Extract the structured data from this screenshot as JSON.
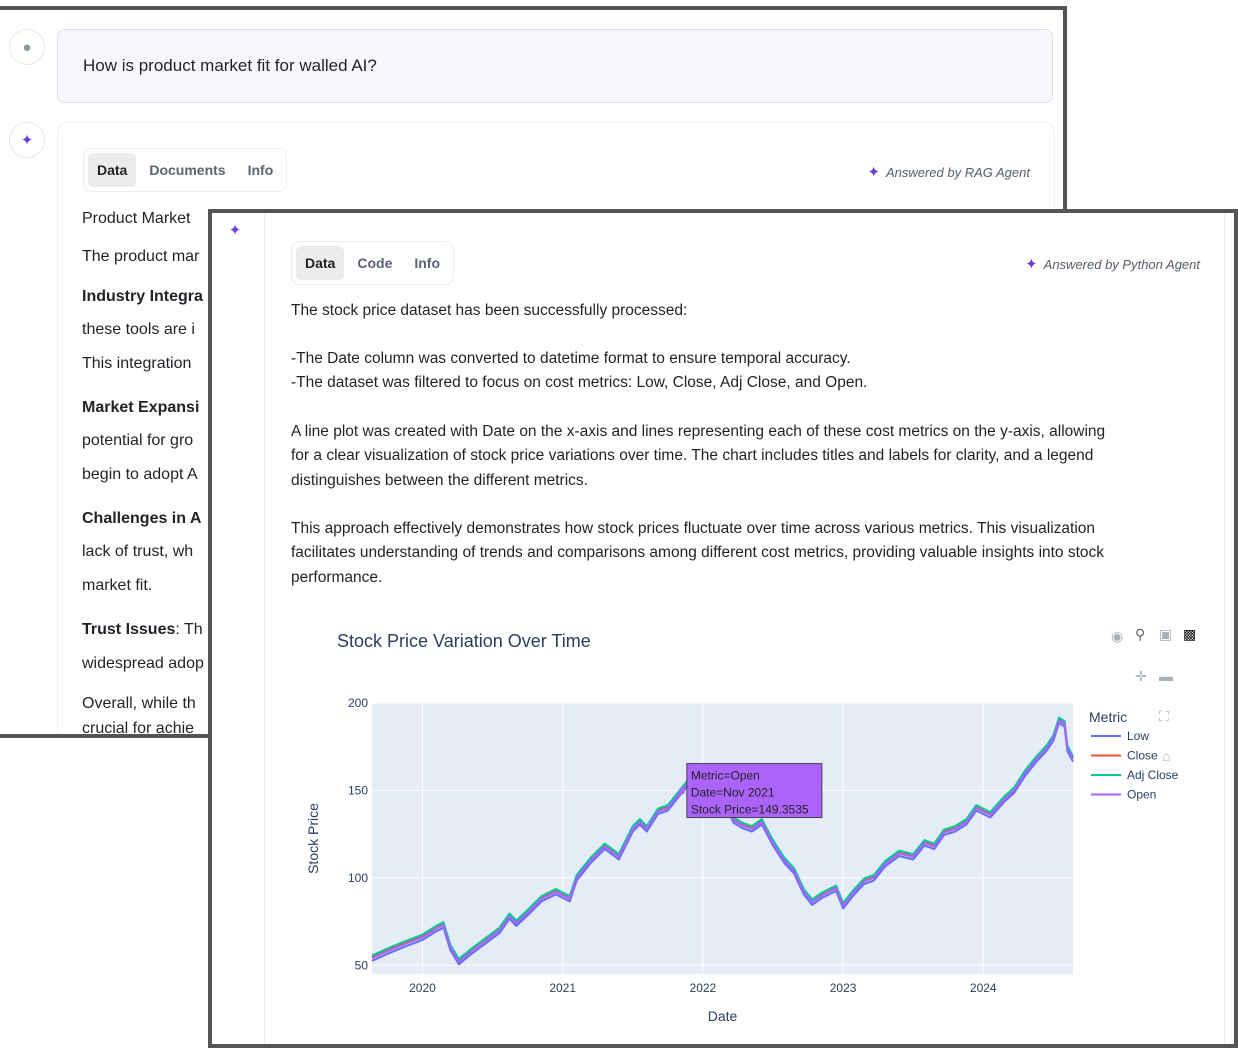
{
  "window_back": {
    "question": "How is product market fit for walled AI?",
    "tabs": [
      "Data",
      "Documents",
      "Info"
    ],
    "answered_by": "Answered by RAG Agent",
    "lines": [
      {
        "bold": "",
        "rest": "Product Market"
      },
      {
        "bold": "",
        "rest": "The product mar"
      },
      {
        "bold": "Industry Integra",
        "rest": ""
      },
      {
        "bold": "",
        "rest": "these tools are i"
      },
      {
        "bold": "",
        "rest": "This integration"
      },
      {
        "bold": "Market Expansi",
        "rest": ""
      },
      {
        "bold": "",
        "rest": "potential for gro"
      },
      {
        "bold": "",
        "rest": "begin to adopt A"
      },
      {
        "bold": "Challenges in A",
        "rest": ""
      },
      {
        "bold": "",
        "rest": "lack of trust, wh"
      },
      {
        "bold": "",
        "rest": "market fit."
      },
      {
        "bold": "Trust Issues",
        "rest": ": Th"
      },
      {
        "bold": "",
        "rest": "widespread adop"
      },
      {
        "bold": "",
        "rest": "Overall, while th"
      },
      {
        "bold": "",
        "rest": "crucial for achie"
      }
    ]
  },
  "window_front": {
    "tabs": [
      "Data",
      "Code",
      "Info"
    ],
    "answered_by": "Answered by Python Agent",
    "paragraphs": [
      [
        "The stock price dataset has been successfully processed:"
      ],
      [
        "-The Date column was converted to datetime format to ensure temporal accuracy.",
        "-The dataset was filtered to focus on cost metrics: Low, Close, Adj Close, and Open."
      ],
      [
        "A line plot was created with Date on the x-axis and lines representing each of these cost metrics on the y-axis, allowing",
        "for a clear visualization of stock price variations over time. The chart includes titles and labels for clarity, and a legend",
        "distinguishes between the different metrics."
      ],
      [
        "This approach effectively demonstrates how stock prices fluctuate over time across various metrics. This visualization",
        "facilitates understanding of trends and comparisons among different cost metrics, providing valuable insights into stock",
        "performance."
      ]
    ]
  },
  "chart_data": {
    "type": "line",
    "title": "Stock Price Variation Over Time",
    "xlabel": "Date",
    "ylabel": "Stock Price",
    "x_ticks": [
      "2020",
      "2021",
      "2022",
      "2023",
      "2024"
    ],
    "y_ticks": [
      50,
      100,
      150,
      200
    ],
    "xlim": [
      2019.64,
      2024.64
    ],
    "ylim": [
      45,
      200
    ],
    "grid": true,
    "legend_title": "Metric",
    "legend_placement": "right",
    "series": [
      {
        "name": "Low",
        "color": "#636efa"
      },
      {
        "name": "Close",
        "color": "#ef553b"
      },
      {
        "name": "Adj Close",
        "color": "#00cc96"
      },
      {
        "name": "Open",
        "color": "#ab63fa"
      }
    ],
    "x": [
      2019.64,
      2019.75,
      2019.87,
      2020.0,
      2020.1,
      2020.15,
      2020.2,
      2020.26,
      2020.35,
      2020.45,
      2020.55,
      2020.62,
      2020.67,
      2020.75,
      2020.85,
      2020.95,
      2021.05,
      2021.1,
      2021.2,
      2021.3,
      2021.4,
      2021.5,
      2021.55,
      2021.6,
      2021.68,
      2021.75,
      2021.8,
      2021.85,
      2021.9,
      2021.95,
      2022.0,
      2022.08,
      2022.15,
      2022.22,
      2022.28,
      2022.35,
      2022.42,
      2022.5,
      2022.58,
      2022.65,
      2022.72,
      2022.78,
      2022.85,
      2022.95,
      2023.0,
      2023.08,
      2023.15,
      2023.22,
      2023.3,
      2023.4,
      2023.5,
      2023.58,
      2023.65,
      2023.72,
      2023.8,
      2023.88,
      2023.95,
      2024.05,
      2024.15,
      2024.22,
      2024.3,
      2024.38,
      2024.45,
      2024.5,
      2024.54,
      2024.58,
      2024.6,
      2024.64
    ],
    "y": [
      54,
      58,
      62,
      66,
      71,
      73,
      60,
      52,
      58,
      64,
      70,
      78,
      74,
      80,
      88,
      92,
      88,
      100,
      110,
      118,
      112,
      128,
      132,
      128,
      138,
      140,
      145,
      150,
      155,
      150,
      149,
      148,
      145,
      133,
      130,
      128,
      132,
      120,
      110,
      104,
      92,
      86,
      90,
      94,
      84,
      92,
      98,
      100,
      108,
      114,
      112,
      120,
      118,
      126,
      128,
      132,
      140,
      136,
      145,
      150,
      160,
      168,
      174,
      180,
      190,
      188,
      174,
      168
    ]
  },
  "tooltip": {
    "metric": "Metric=Open",
    "date": "Date=Nov 2021",
    "price": "Stock Price=149.3535"
  }
}
